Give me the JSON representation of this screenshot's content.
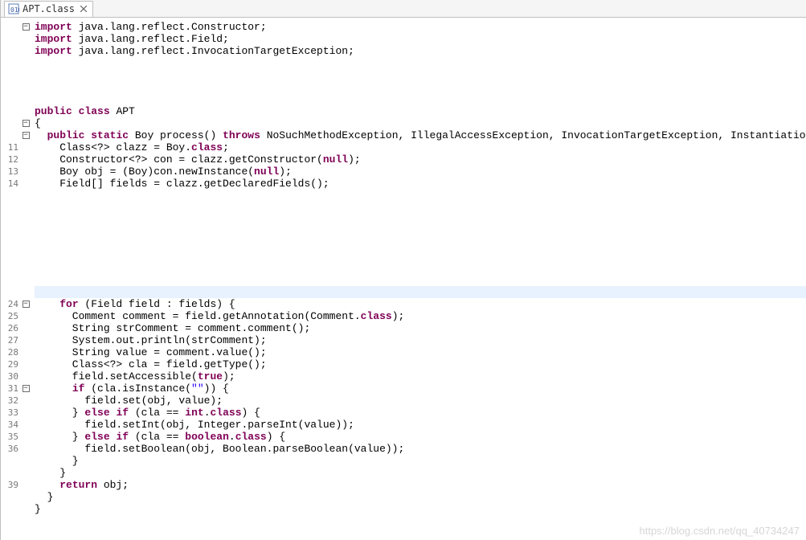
{
  "tab": {
    "filename": "APT.class",
    "icon": "java-class-icon"
  },
  "lines": [
    {
      "lineno": "",
      "fold": "minus",
      "tokens": [
        {
          "t": "kw",
          "v": "import"
        },
        {
          "t": "plain",
          "v": " java.lang.reflect.Constructor;"
        }
      ]
    },
    {
      "lineno": "",
      "fold": "",
      "tokens": [
        {
          "t": "kw",
          "v": "import"
        },
        {
          "t": "plain",
          "v": " java.lang.reflect.Field;"
        }
      ]
    },
    {
      "lineno": "",
      "fold": "",
      "tokens": [
        {
          "t": "kw",
          "v": "import"
        },
        {
          "t": "plain",
          "v": " java.lang.reflect.InvocationTargetException;"
        }
      ]
    },
    {
      "lineno": "",
      "fold": "",
      "tokens": []
    },
    {
      "lineno": "",
      "fold": "",
      "tokens": []
    },
    {
      "lineno": "",
      "fold": "",
      "tokens": []
    },
    {
      "lineno": "",
      "fold": "",
      "tokens": []
    },
    {
      "lineno": "",
      "fold": "",
      "tokens": [
        {
          "t": "kw",
          "v": "public"
        },
        {
          "t": "plain",
          "v": " "
        },
        {
          "t": "kw",
          "v": "class"
        },
        {
          "t": "plain",
          "v": " APT"
        }
      ]
    },
    {
      "lineno": "",
      "fold": "minus",
      "tokens": [
        {
          "t": "plain",
          "v": "{"
        }
      ]
    },
    {
      "lineno": "",
      "fold": "minus",
      "tokens": [
        {
          "t": "plain",
          "v": "  "
        },
        {
          "t": "kw",
          "v": "public"
        },
        {
          "t": "plain",
          "v": " "
        },
        {
          "t": "kw",
          "v": "static"
        },
        {
          "t": "plain",
          "v": " Boy process() "
        },
        {
          "t": "kw",
          "v": "throws"
        },
        {
          "t": "plain",
          "v": " NoSuchMethodException, IllegalAccessException, InvocationTargetException, InstantiationException {"
        }
      ]
    },
    {
      "lineno": "11",
      "fold": "",
      "tokens": [
        {
          "t": "plain",
          "v": "    Class<?> clazz = Boy."
        },
        {
          "t": "kw",
          "v": "class"
        },
        {
          "t": "plain",
          "v": ";"
        }
      ]
    },
    {
      "lineno": "12",
      "fold": "",
      "tokens": [
        {
          "t": "plain",
          "v": "    Constructor<?> con = clazz.getConstructor("
        },
        {
          "t": "kw",
          "v": "null"
        },
        {
          "t": "plain",
          "v": ");"
        }
      ]
    },
    {
      "lineno": "13",
      "fold": "",
      "tokens": [
        {
          "t": "plain",
          "v": "    Boy obj = (Boy)con.newInstance("
        },
        {
          "t": "kw",
          "v": "null"
        },
        {
          "t": "plain",
          "v": ");"
        }
      ]
    },
    {
      "lineno": "14",
      "fold": "",
      "tokens": [
        {
          "t": "plain",
          "v": "    Field[] fields = clazz.getDeclaredFields();"
        }
      ]
    },
    {
      "lineno": "",
      "fold": "",
      "tokens": []
    },
    {
      "lineno": "",
      "fold": "",
      "tokens": []
    },
    {
      "lineno": "",
      "fold": "",
      "tokens": []
    },
    {
      "lineno": "",
      "fold": "",
      "tokens": []
    },
    {
      "lineno": "",
      "fold": "",
      "tokens": []
    },
    {
      "lineno": "",
      "fold": "",
      "tokens": []
    },
    {
      "lineno": "",
      "fold": "",
      "tokens": []
    },
    {
      "lineno": "",
      "fold": "",
      "tokens": []
    },
    {
      "lineno": "",
      "fold": "",
      "hl": true,
      "tokens": []
    },
    {
      "lineno": "24",
      "fold": "minus",
      "tokens": [
        {
          "t": "plain",
          "v": "    "
        },
        {
          "t": "kw",
          "v": "for"
        },
        {
          "t": "plain",
          "v": " (Field field : fields) {"
        }
      ]
    },
    {
      "lineno": "25",
      "fold": "",
      "tokens": [
        {
          "t": "plain",
          "v": "      Comment comment = field.getAnnotation(Comment."
        },
        {
          "t": "kw",
          "v": "class"
        },
        {
          "t": "plain",
          "v": ");"
        }
      ]
    },
    {
      "lineno": "26",
      "fold": "",
      "tokens": [
        {
          "t": "plain",
          "v": "      String strComment = comment.comment();"
        }
      ]
    },
    {
      "lineno": "27",
      "fold": "",
      "tokens": [
        {
          "t": "plain",
          "v": "      System.out.println(strComment);"
        }
      ]
    },
    {
      "lineno": "28",
      "fold": "",
      "tokens": [
        {
          "t": "plain",
          "v": "      String value = comment.value();"
        }
      ]
    },
    {
      "lineno": "29",
      "fold": "",
      "tokens": [
        {
          "t": "plain",
          "v": "      Class<?> cla = field.getType();"
        }
      ]
    },
    {
      "lineno": "30",
      "fold": "",
      "tokens": [
        {
          "t": "plain",
          "v": "      field.setAccessible("
        },
        {
          "t": "kw",
          "v": "true"
        },
        {
          "t": "plain",
          "v": ");"
        }
      ]
    },
    {
      "lineno": "31",
      "fold": "minus",
      "tokens": [
        {
          "t": "plain",
          "v": "      "
        },
        {
          "t": "kw",
          "v": "if"
        },
        {
          "t": "plain",
          "v": " (cla.isInstance("
        },
        {
          "t": "str",
          "v": "\"\""
        },
        {
          "t": "plain",
          "v": ")) {"
        }
      ]
    },
    {
      "lineno": "32",
      "fold": "",
      "tokens": [
        {
          "t": "plain",
          "v": "        field.set(obj, value);"
        }
      ]
    },
    {
      "lineno": "33",
      "fold": "",
      "tokens": [
        {
          "t": "plain",
          "v": "      } "
        },
        {
          "t": "kw",
          "v": "else"
        },
        {
          "t": "plain",
          "v": " "
        },
        {
          "t": "kw",
          "v": "if"
        },
        {
          "t": "plain",
          "v": " (cla == "
        },
        {
          "t": "kw",
          "v": "int"
        },
        {
          "t": "plain",
          "v": "."
        },
        {
          "t": "kw",
          "v": "class"
        },
        {
          "t": "plain",
          "v": ") {"
        }
      ]
    },
    {
      "lineno": "34",
      "fold": "",
      "tokens": [
        {
          "t": "plain",
          "v": "        field.setInt(obj, Integer.parseInt(value));"
        }
      ]
    },
    {
      "lineno": "35",
      "fold": "",
      "tokens": [
        {
          "t": "plain",
          "v": "      } "
        },
        {
          "t": "kw",
          "v": "else"
        },
        {
          "t": "plain",
          "v": " "
        },
        {
          "t": "kw",
          "v": "if"
        },
        {
          "t": "plain",
          "v": " (cla == "
        },
        {
          "t": "kw",
          "v": "boolean"
        },
        {
          "t": "plain",
          "v": "."
        },
        {
          "t": "kw",
          "v": "class"
        },
        {
          "t": "plain",
          "v": ") {"
        }
      ]
    },
    {
      "lineno": "36",
      "fold": "",
      "tokens": [
        {
          "t": "plain",
          "v": "        field.setBoolean(obj, Boolean.parseBoolean(value));"
        }
      ]
    },
    {
      "lineno": "",
      "fold": "",
      "tokens": [
        {
          "t": "plain",
          "v": "      }"
        }
      ]
    },
    {
      "lineno": "",
      "fold": "",
      "tokens": [
        {
          "t": "plain",
          "v": "    }"
        }
      ]
    },
    {
      "lineno": "39",
      "fold": "",
      "tokens": [
        {
          "t": "plain",
          "v": "    "
        },
        {
          "t": "kw",
          "v": "return"
        },
        {
          "t": "plain",
          "v": " obj;"
        }
      ]
    },
    {
      "lineno": "",
      "fold": "",
      "tokens": [
        {
          "t": "plain",
          "v": "  }"
        }
      ]
    },
    {
      "lineno": "",
      "fold": "",
      "tokens": [
        {
          "t": "plain",
          "v": "}"
        }
      ]
    }
  ],
  "watermark": "https://blog.csdn.net/qq_40734247"
}
